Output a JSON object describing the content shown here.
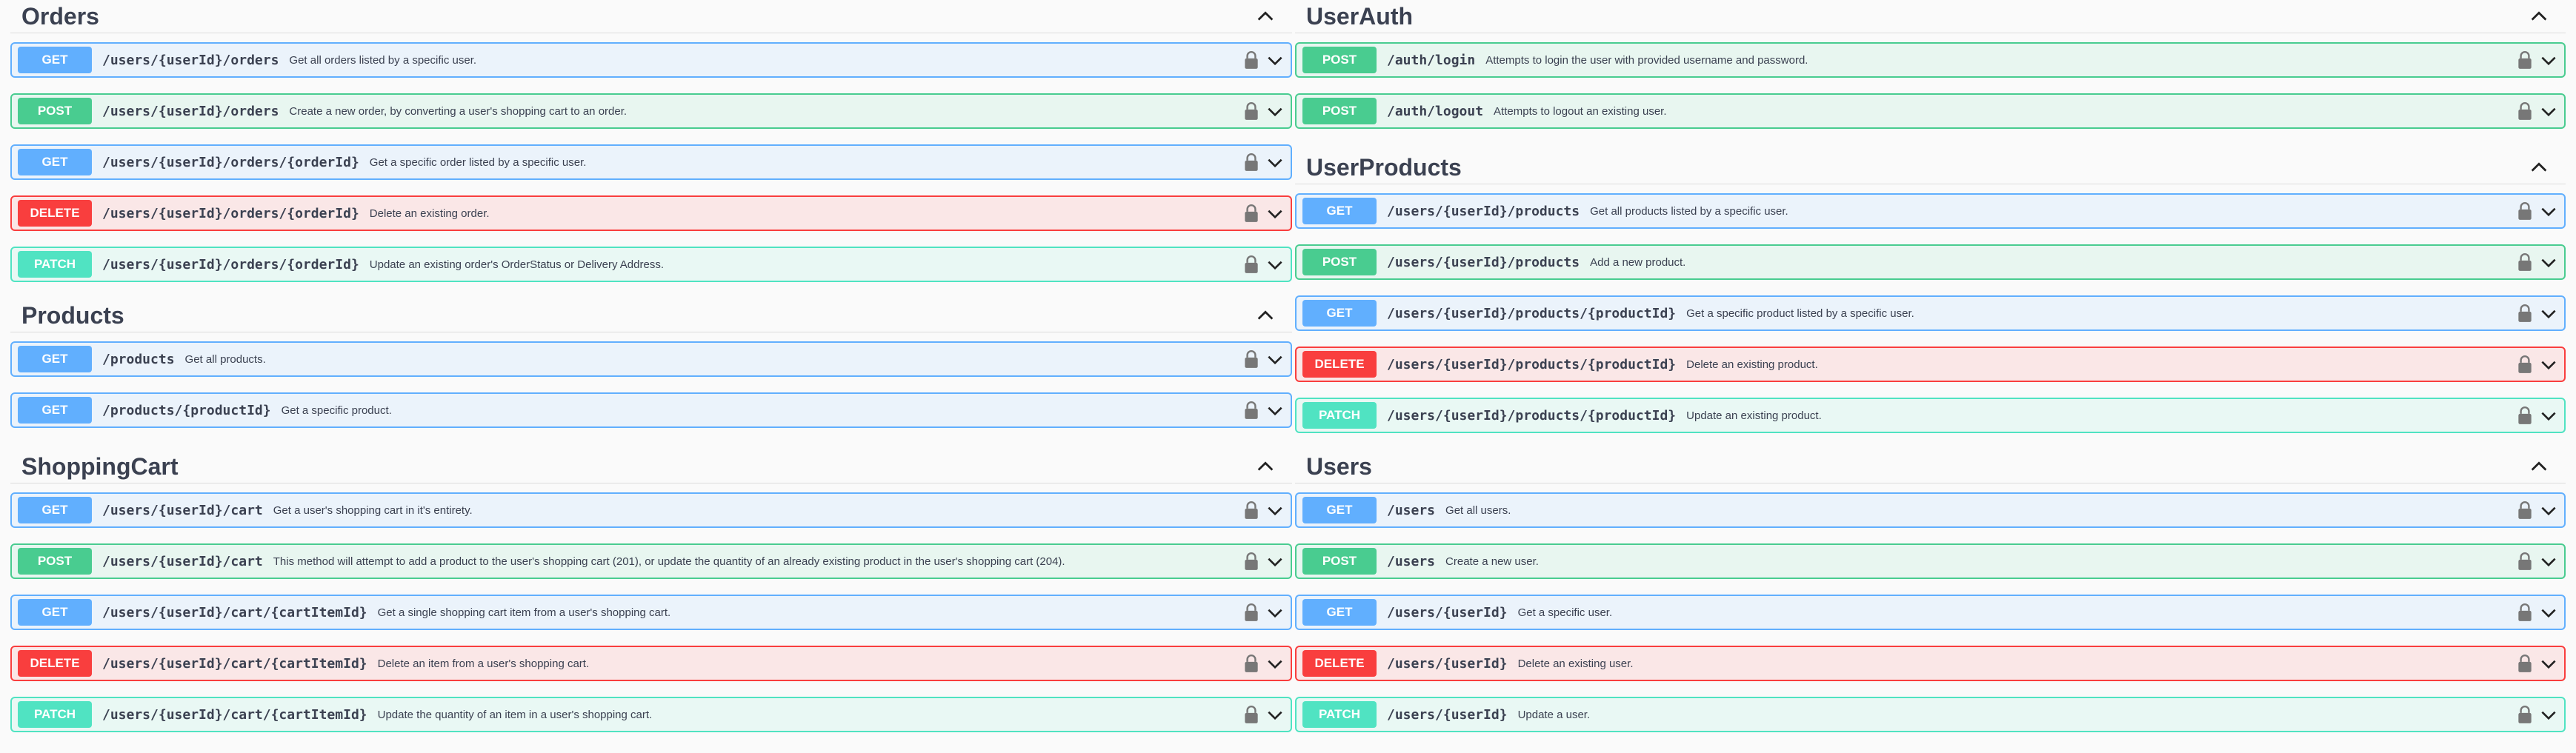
{
  "icons": {
    "lock": "lock-icon",
    "chevron_down": "chevron-down-icon",
    "chevron_up": "chevron-up-icon"
  },
  "colors": {
    "get": "#61affe",
    "post": "#49cc90",
    "delete": "#f93e3e",
    "patch": "#50e3c2"
  },
  "orders": {
    "title": "Orders",
    "ops": [
      {
        "method": "GET",
        "path": "/users/{userId}/orders",
        "summary": "Get all orders listed by a specific user."
      },
      {
        "method": "POST",
        "path": "/users/{userId}/orders",
        "summary": "Create a new order, by converting a user's shopping cart to an order."
      },
      {
        "method": "GET",
        "path": "/users/{userId}/orders/{orderId}",
        "summary": "Get a specific order listed by a specific user."
      },
      {
        "method": "DELETE",
        "path": "/users/{userId}/orders/{orderId}",
        "summary": "Delete an existing order."
      },
      {
        "method": "PATCH",
        "path": "/users/{userId}/orders/{orderId}",
        "summary": "Update an existing order's OrderStatus or Delivery Address."
      }
    ]
  },
  "products": {
    "title": "Products",
    "ops": [
      {
        "method": "GET",
        "path": "/products",
        "summary": "Get all products."
      },
      {
        "method": "GET",
        "path": "/products/{productId}",
        "summary": "Get a specific product."
      }
    ]
  },
  "shoppingcart": {
    "title": "ShoppingCart",
    "ops": [
      {
        "method": "GET",
        "path": "/users/{userId}/cart",
        "summary": "Get a user's shopping cart in it's entirety."
      },
      {
        "method": "POST",
        "path": "/users/{userId}/cart",
        "summary": "This method will attempt to add a product to the user's shopping cart (201), or update the quantity of an already existing product in the user's shopping cart (204)."
      },
      {
        "method": "GET",
        "path": "/users/{userId}/cart/{cartItemId}",
        "summary": "Get a single shopping cart item from a user's shopping cart."
      },
      {
        "method": "DELETE",
        "path": "/users/{userId}/cart/{cartItemId}",
        "summary": "Delete an item from a user's shopping cart."
      },
      {
        "method": "PATCH",
        "path": "/users/{userId}/cart/{cartItemId}",
        "summary": "Update the quantity of an item in a user's shopping cart."
      }
    ]
  },
  "userauth": {
    "title": "UserAuth",
    "ops": [
      {
        "method": "POST",
        "path": "/auth/login",
        "summary": "Attempts to login the user with provided username and password."
      },
      {
        "method": "POST",
        "path": "/auth/logout",
        "summary": "Attempts to logout an existing user."
      }
    ]
  },
  "userproducts": {
    "title": "UserProducts",
    "ops": [
      {
        "method": "GET",
        "path": "/users/{userId}/products",
        "summary": "Get all products listed by a specific user."
      },
      {
        "method": "POST",
        "path": "/users/{userId}/products",
        "summary": "Add a new product."
      },
      {
        "method": "GET",
        "path": "/users/{userId}/products/{productId}",
        "summary": "Get a specific product listed by a specific user."
      },
      {
        "method": "DELETE",
        "path": "/users/{userId}/products/{productId}",
        "summary": "Delete an existing product."
      },
      {
        "method": "PATCH",
        "path": "/users/{userId}/products/{productId}",
        "summary": "Update an existing product."
      }
    ]
  },
  "users": {
    "title": "Users",
    "ops": [
      {
        "method": "GET",
        "path": "/users",
        "summary": "Get all users."
      },
      {
        "method": "POST",
        "path": "/users",
        "summary": "Create a new user."
      },
      {
        "method": "GET",
        "path": "/users/{userId}",
        "summary": "Get a specific user."
      },
      {
        "method": "DELETE",
        "path": "/users/{userId}",
        "summary": "Delete an existing user."
      },
      {
        "method": "PATCH",
        "path": "/users/{userId}",
        "summary": "Update a user."
      }
    ]
  }
}
